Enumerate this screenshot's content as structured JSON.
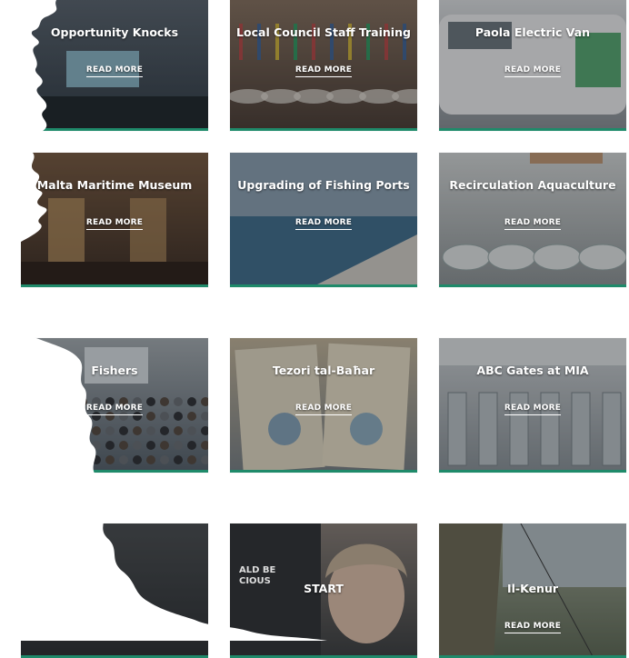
{
  "colors": {
    "accent": "#1f8a6a",
    "page_bg": "#f4f4f4"
  },
  "cards": [
    {
      "title": "Opportunity Knocks",
      "link": "READ MORE",
      "theme": "people-laptop",
      "bg": "#2f3a44",
      "bg2": "#5b6570"
    },
    {
      "title": "Local Council Staff Training",
      "link": "READ MORE",
      "theme": "conference-hall",
      "bg": "#4a3b33",
      "bg2": "#8a7360"
    },
    {
      "title": "Paola Electric Van",
      "link": "READ MORE",
      "theme": "white-van",
      "bg": "#8a9096",
      "bg2": "#e6e8ea"
    },
    {
      "title": "Malta Maritime Museum",
      "link": "READ MORE",
      "theme": "museum",
      "bg": "#3a2a20",
      "bg2": "#7a5a3f"
    },
    {
      "title": "Upgrading of Fishing Ports",
      "link": "READ MORE",
      "theme": "harbour",
      "bg": "#546a7d",
      "bg2": "#9fb3c1"
    },
    {
      "title": "Recirculation Aquaculture",
      "link": "READ MORE",
      "theme": "tanks",
      "bg": "#8f9597",
      "bg2": "#d9dcdc"
    },
    {
      "title": "Fishers",
      "link": "READ MORE",
      "theme": "audience",
      "bg": "#55606b",
      "bg2": "#a9b0b5"
    },
    {
      "title": "Tezori tal-Baħar",
      "link": "READ MORE",
      "theme": "posters",
      "bg": "#7a8186",
      "bg2": "#c7b89c"
    },
    {
      "title": "ABC Gates at MIA",
      "link": "READ MORE",
      "theme": "gates",
      "bg": "#8c949a",
      "bg2": "#d3d7da"
    },
    {
      "title": "",
      "link": "",
      "theme": "dark",
      "bg": "#2a2d30",
      "bg2": "#4a4d50"
    },
    {
      "title": "START",
      "link": "",
      "theme": "portrait",
      "bg": "#3a3c3e",
      "bg2": "#8a7f77",
      "overlay_text": "ALD BE\nCIOUS"
    },
    {
      "title": "Il-Kenur",
      "link": "READ MORE",
      "theme": "cliff",
      "bg": "#5f6a55",
      "bg2": "#a7ae9a"
    }
  ]
}
